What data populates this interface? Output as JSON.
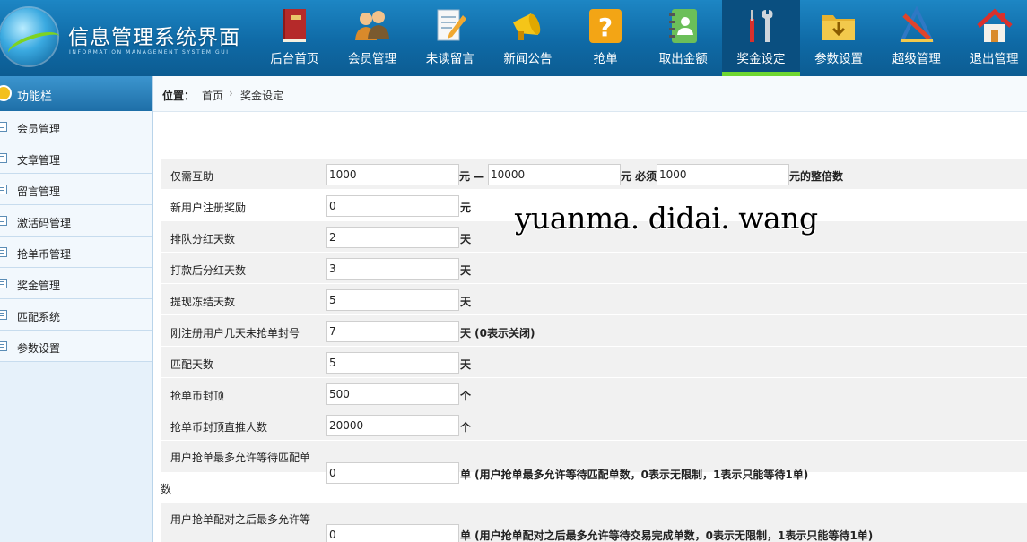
{
  "header": {
    "title": "信息管理系统界面",
    "subtitle": "INFORMATION MANAGEMENT SYSTEM GUI",
    "nav": [
      {
        "label": "后台首页",
        "icon": "book-icon"
      },
      {
        "label": "会员管理",
        "icon": "users-icon"
      },
      {
        "label": "未读留言",
        "icon": "document-pen-icon"
      },
      {
        "label": "新闻公告",
        "icon": "megaphone-icon"
      },
      {
        "label": "抢单",
        "icon": "question-icon"
      },
      {
        "label": "取出金额",
        "icon": "address-book-icon"
      },
      {
        "label": "奖金设定",
        "icon": "tools-icon",
        "active": true
      },
      {
        "label": "参数设置",
        "icon": "folder-download-icon"
      },
      {
        "label": "超级管理",
        "icon": "ruler-pen-icon"
      },
      {
        "label": "退出管理",
        "icon": "home-icon"
      }
    ]
  },
  "sidebar": {
    "title": "功能栏",
    "items": [
      "会员管理",
      "文章管理",
      "留言管理",
      "激活码管理",
      "抢单币管理",
      "奖金管理",
      "匹配系统",
      "参数设置"
    ]
  },
  "breadcrumb": {
    "prefix": "位置：",
    "home": "首页",
    "separator": "›",
    "current": "奖金设定"
  },
  "form": {
    "row1": {
      "label": "仅需互助",
      "min": "1000",
      "dash": "元 —",
      "max": "10000",
      "must": "元 必须",
      "multiple": "1000",
      "suffix": "元的整倍数"
    },
    "row2": {
      "label": "新用户注册奖励",
      "value": "0",
      "unit": "元"
    },
    "row3": {
      "label": "排队分红天数",
      "value": "2",
      "unit": "天"
    },
    "row4": {
      "label": "打款后分红天数",
      "value": "3",
      "unit": "天"
    },
    "row5": {
      "label": "提现冻结天数",
      "value": "5",
      "unit": "天"
    },
    "row6": {
      "label": "刚注册用户几天未抢单封号",
      "value": "7",
      "unit": "天 (0表示关闭)"
    },
    "row7": {
      "label": "匹配天数",
      "value": "5",
      "unit": "天"
    },
    "row8": {
      "label": "抢单币封顶",
      "value": "500",
      "unit": "个"
    },
    "row9": {
      "label": "抢单币封顶直推人数",
      "value": "20000",
      "unit": "个"
    },
    "row10": {
      "label_line1": "用户抢单最多允许等待匹配单",
      "label_line2": "数",
      "value": "0",
      "unit": "单 (用户抢单最多允许等待匹配单数，0表示无限制，1表示只能等待1单)"
    },
    "row11": {
      "label_line1": "用户抢单配对之后最多允许等",
      "value": "0",
      "unit": "单 (用户抢单配对之后最多允许等待交易完成单数，0表示无限制，1表示只能等待1单)"
    }
  },
  "watermark": "yuanma. didai. wang"
}
